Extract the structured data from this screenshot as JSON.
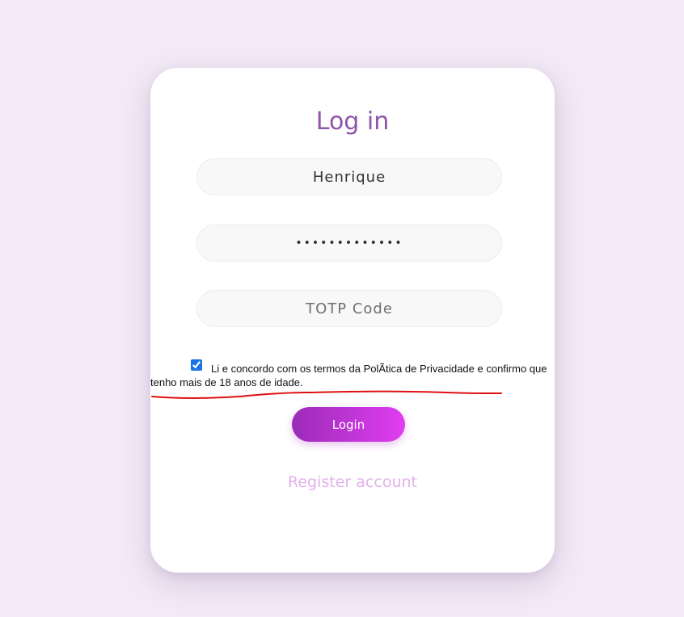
{
  "login_card": {
    "title": "Log in",
    "username": {
      "value": "Henrique"
    },
    "password": {
      "value": "•••••••••••••"
    },
    "totp": {
      "placeholder": "TOTP Code"
    },
    "consent": {
      "checked": true,
      "line1": "Li e concordo com os termos da PolÃtica de Privacidade e confirmo que",
      "line2": "tenho mais de 18 anos de idade."
    },
    "login_label": "Login",
    "register_label": "Register account"
  },
  "colors": {
    "background": "#f2eaf6",
    "title": "#8e55a8",
    "button_gradient_start": "#9b2bb8",
    "button_gradient_end": "#e03ef0",
    "register_link": "#e2b1ea",
    "annotation_underline": "#e01010"
  }
}
